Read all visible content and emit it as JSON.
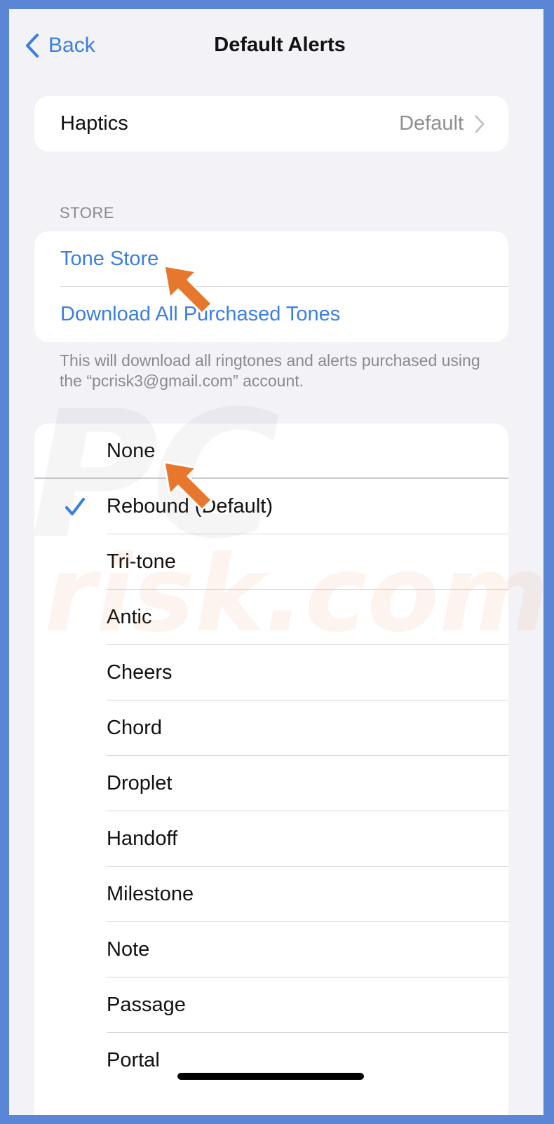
{
  "nav": {
    "back_label": "Back",
    "title": "Default Alerts"
  },
  "haptics": {
    "label": "Haptics",
    "value": "Default"
  },
  "store": {
    "header": "STORE",
    "items": [
      "Tone Store",
      "Download All Purchased Tones"
    ],
    "footer": "This will download all ringtones and alerts purchased using the “pcrisk3@gmail.com” account."
  },
  "tones": {
    "none_label": "None",
    "selected_index": 0,
    "items": [
      "Rebound (Default)",
      "Tri-tone",
      "Antic",
      "Cheers",
      "Chord",
      "Droplet",
      "Handoff",
      "Milestone",
      "Note",
      "Passage",
      "Portal"
    ]
  },
  "colors": {
    "accent": "#3a7ee4",
    "frame": "#5b86d6",
    "arrow": "#e8772e",
    "background": "#f2f2f7"
  },
  "icons": {
    "back": "chevron-left-icon",
    "disclosure": "chevron-right-icon",
    "selected": "checkmark-icon",
    "annotation": "arrow-pointer-icon"
  }
}
